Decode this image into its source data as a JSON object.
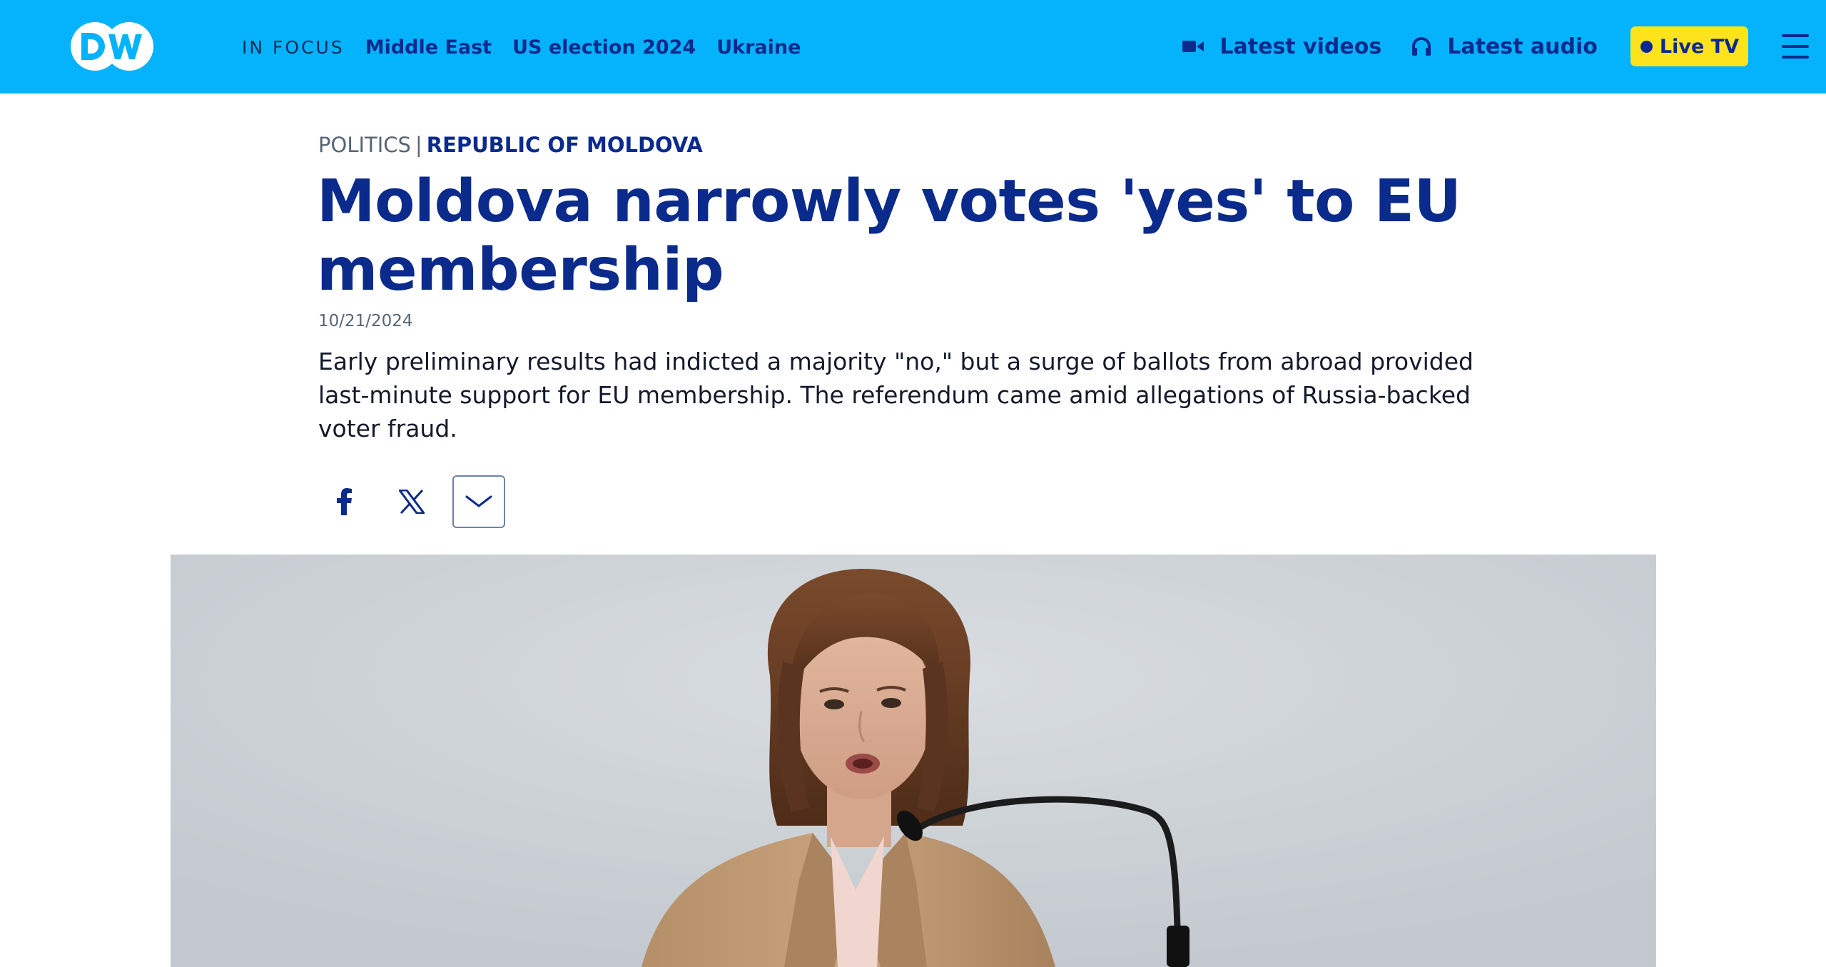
{
  "header": {
    "logo_text": "DW",
    "in_focus_label": "IN FOCUS",
    "focus_links": [
      "Middle East",
      "US election 2024",
      "Ukraine"
    ],
    "latest_videos_label": "Latest videos",
    "latest_audio_label": "Latest audio",
    "live_tv_label": "Live TV",
    "icons": {
      "videos": "video-camera-icon",
      "audio": "headphones-icon",
      "live": "live-dot-icon",
      "menu": "hamburger-menu-icon"
    }
  },
  "article": {
    "category": "POLITICS",
    "separator": "|",
    "region": "REPUBLIC OF MOLDOVA",
    "headline": "Moldova narrowly votes 'yes' to EU membership",
    "date": "10/21/2024",
    "teaser": "Early preliminary results had indicted a majority \"no,\" but a surge of ballots from abroad provided last-minute support for EU membership. The referendum came amid allegations of Russia-backed voter fraud."
  },
  "share": {
    "buttons": [
      "facebook-icon",
      "x-icon",
      "chevron-down-icon"
    ]
  },
  "hero_image": {
    "subject": "woman speaking at a microphone"
  },
  "colors": {
    "topbar": "#05b2fc",
    "brand_navy": "#0a2a8c",
    "live_yellow": "#fde31b",
    "meta_gray": "#566575",
    "body_text": "#131a2a"
  }
}
